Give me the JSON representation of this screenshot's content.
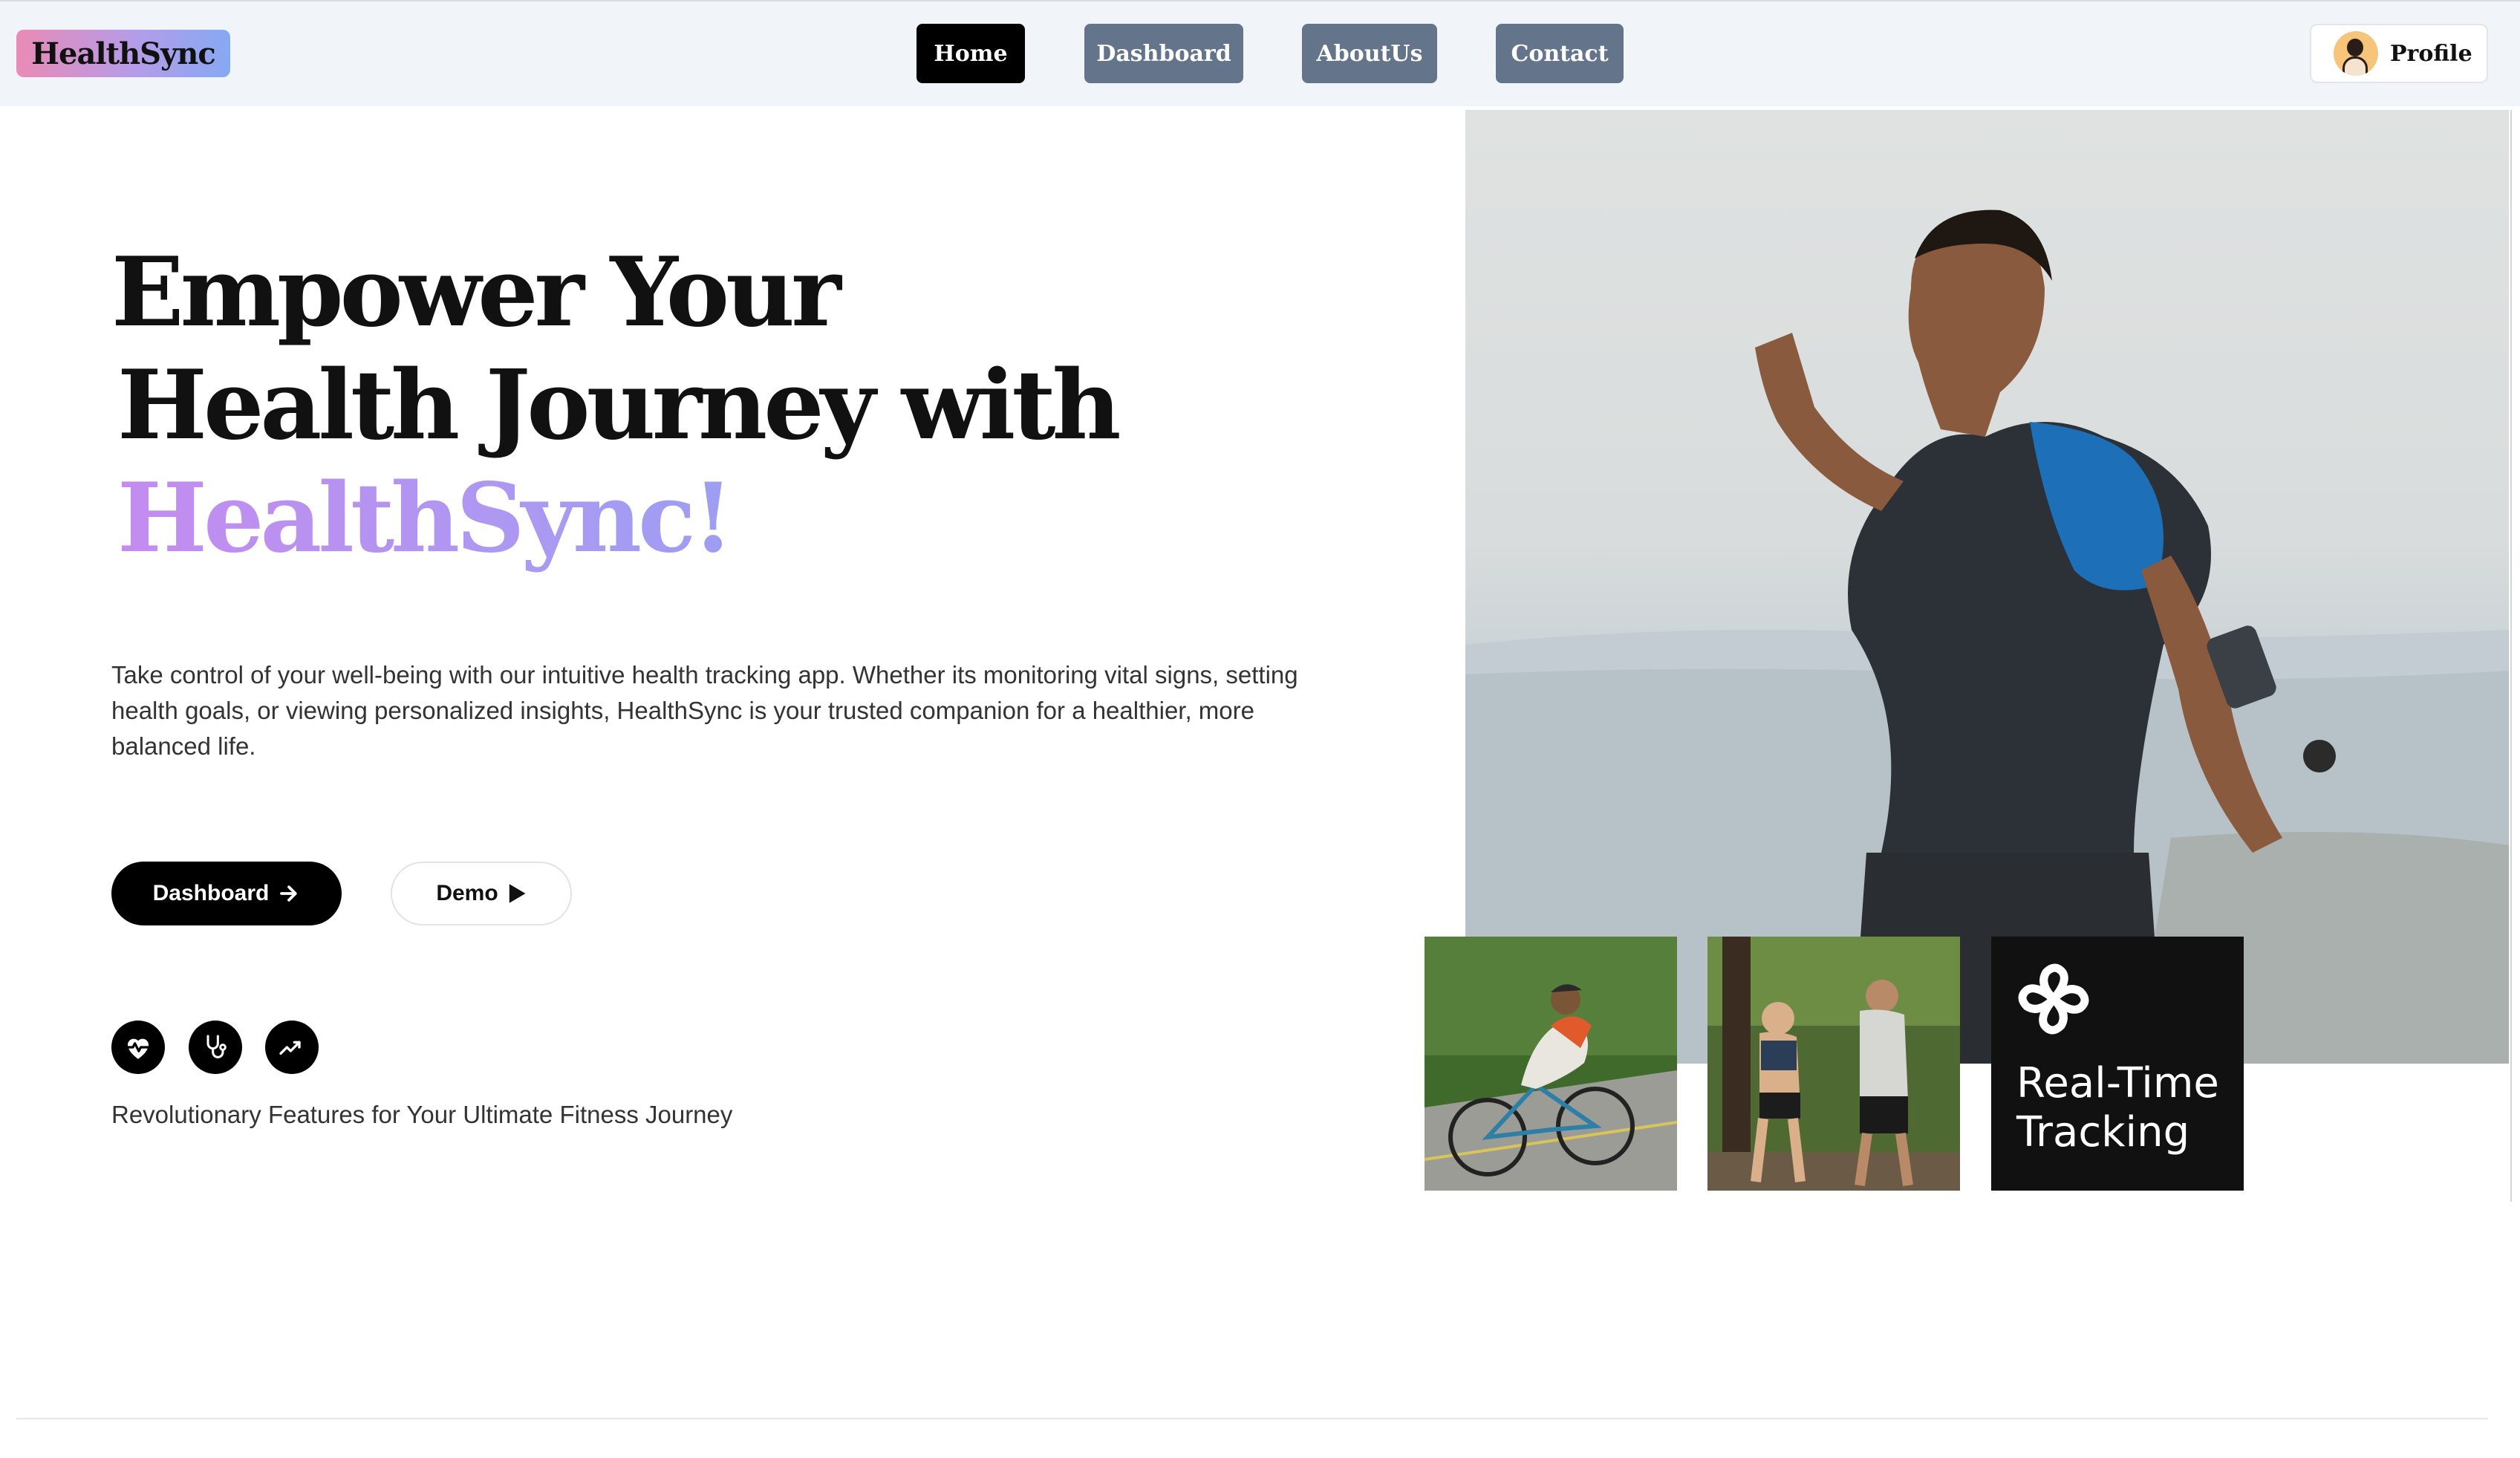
{
  "header": {
    "logo": "HealthSync",
    "nav": [
      {
        "label": "Home",
        "active": true
      },
      {
        "label": "Dashboard",
        "active": false
      },
      {
        "label": "AboutUs",
        "active": false
      },
      {
        "label": "Contact",
        "active": false
      }
    ],
    "profile_label": "Profile"
  },
  "hero": {
    "headline_line1": "Empower Your",
    "headline_line2": "Health Journey with",
    "headline_brand": "HealthSync!",
    "description": "Take control of your well-being with our intuitive health tracking app. Whether its monitoring vital signs, setting health goals, or viewing personalized insights, HealthSync is your trusted companion for a healthier, more balanced life.",
    "primary_button": "Dashboard",
    "secondary_button": "Demo",
    "feature_icons": [
      "heart-pulse-icon",
      "stethoscope-icon",
      "trend-up-icon"
    ],
    "features_caption": "Revolutionary Features for Your Ultimate Fitness Journey"
  },
  "gallery": {
    "card_title_line1": "Real-Time",
    "card_title_line2": "Tracking",
    "card_icon": "cross-knot-icon"
  },
  "colors": {
    "nav_bg": "#f1f5f9",
    "nav_button": "#64748b",
    "nav_active": "#000000",
    "brand_gradient_start": "#c58bf0",
    "brand_gradient_end": "#7fa7f0"
  }
}
